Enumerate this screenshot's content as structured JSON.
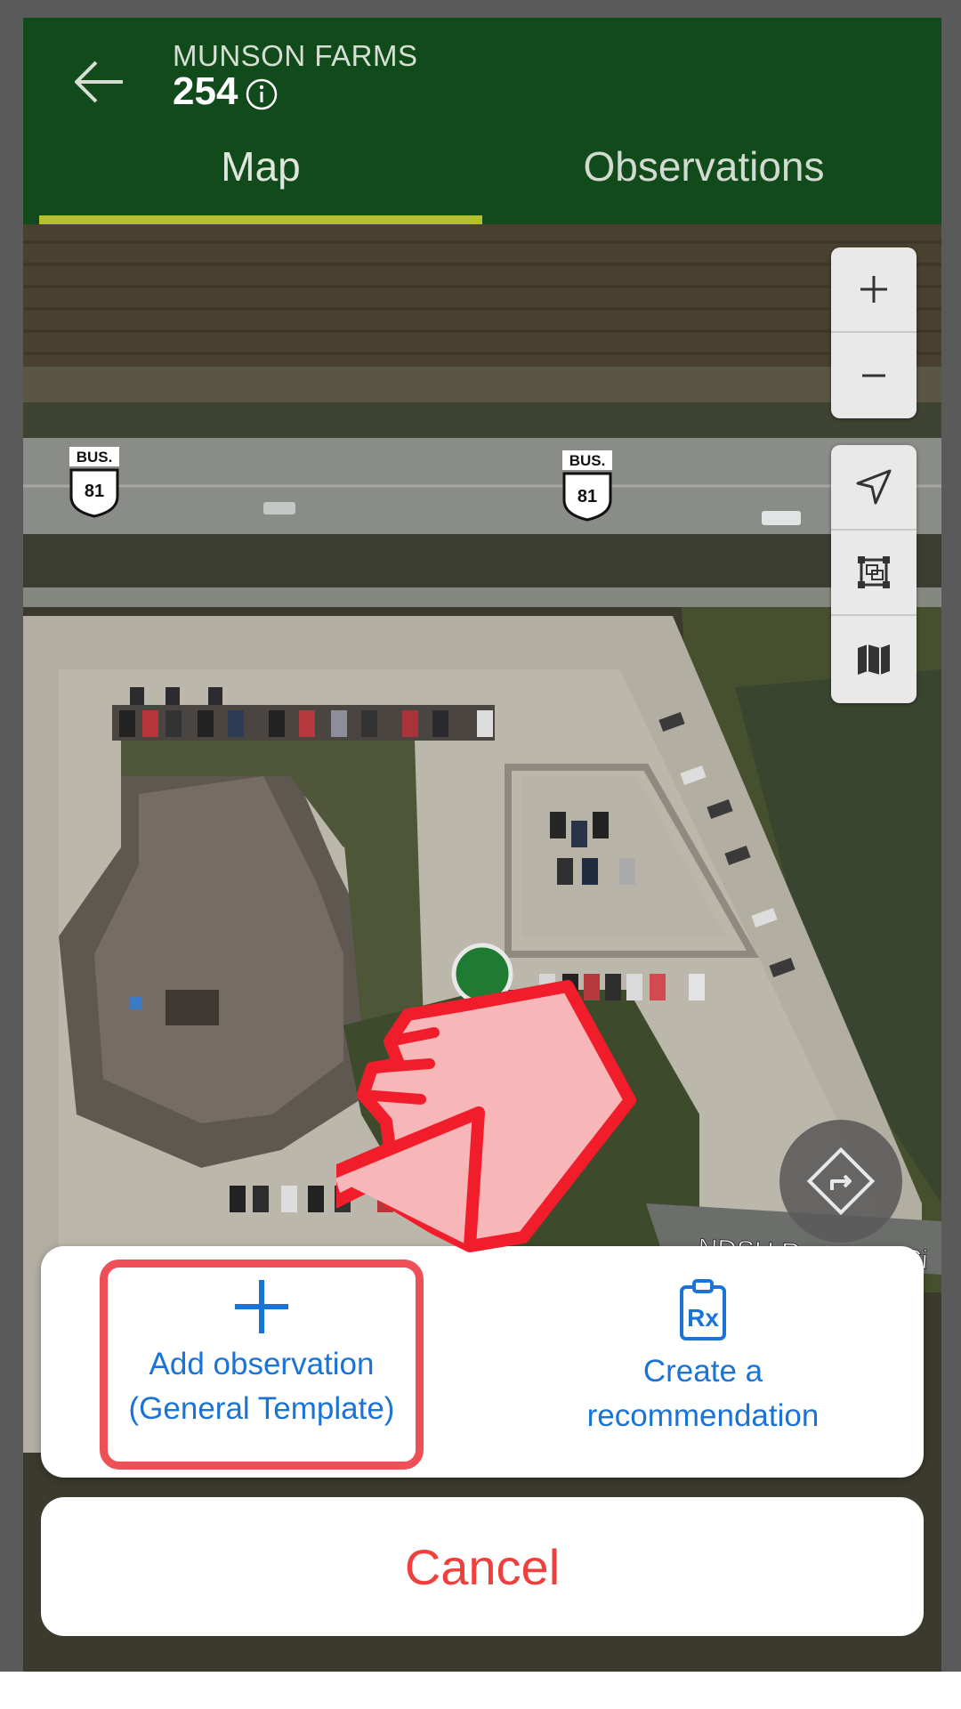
{
  "header": {
    "farm_name": "MUNSON FARMS",
    "field_number": "254",
    "back_icon": "arrow-left-icon",
    "info_icon": "info-circle-icon"
  },
  "tabs": [
    {
      "label": "Map",
      "active": true
    },
    {
      "label": "Observations",
      "active": false
    }
  ],
  "map": {
    "road_shields": [
      {
        "top": "BUS.",
        "number": "81"
      },
      {
        "top": "BUS.",
        "number": "81"
      }
    ],
    "street_label": "NDSU Research Ci",
    "controls": {
      "zoom_in": "plus-icon",
      "zoom_out": "minus-icon",
      "locate": "navigation-arrow-icon",
      "fit_bounds": "frame-icon",
      "map_layers": "map-icon",
      "route": "directions-icon"
    }
  },
  "action_sheet": {
    "add_observation": {
      "line1": "Add observation",
      "line2": "(General Template)",
      "icon": "plus-icon"
    },
    "create_recommendation": {
      "line1": "Create a",
      "line2": "recommendation",
      "icon": "clipboard-rx-icon"
    },
    "cancel_label": "Cancel"
  },
  "colors": {
    "header_green": "#114b1b",
    "tab_underline": "#b6c12a",
    "action_blue": "#1a73d6",
    "cancel_red": "#f0403d",
    "highlight_red": "#ef5057",
    "marker_green": "#1f7a32"
  }
}
